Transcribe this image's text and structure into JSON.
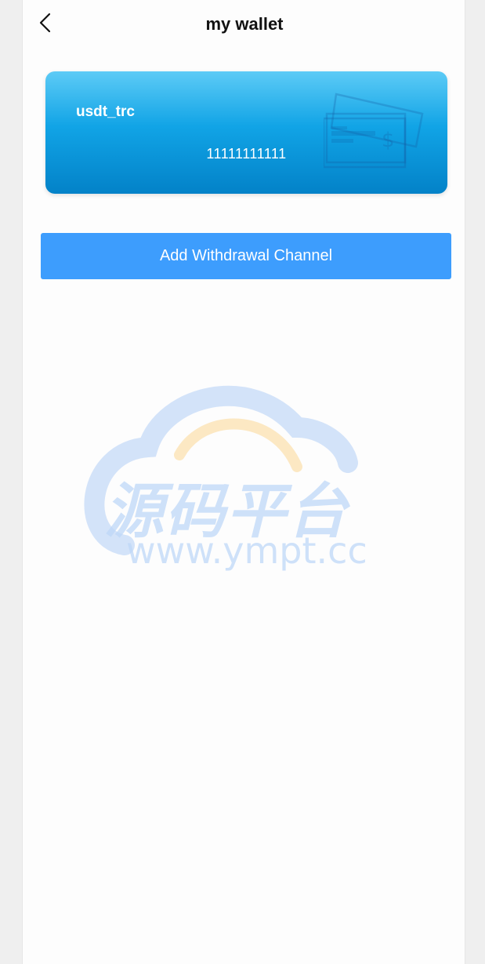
{
  "header": {
    "title": "my wallet",
    "back_icon": "chevron-left-icon"
  },
  "wallet_card": {
    "name": "usdt_trc",
    "number": "11111111111",
    "icon": "cheque-dollar-icon",
    "colors": {
      "gradient_top": "#5dcbf6",
      "gradient_bottom": "#0382c8"
    }
  },
  "actions": {
    "add_label": "Add Withdrawal Channel",
    "button_color": "#3d9dfd"
  },
  "watermark": {
    "text_cn": "源码平台",
    "url": "www.ympt.cc"
  }
}
